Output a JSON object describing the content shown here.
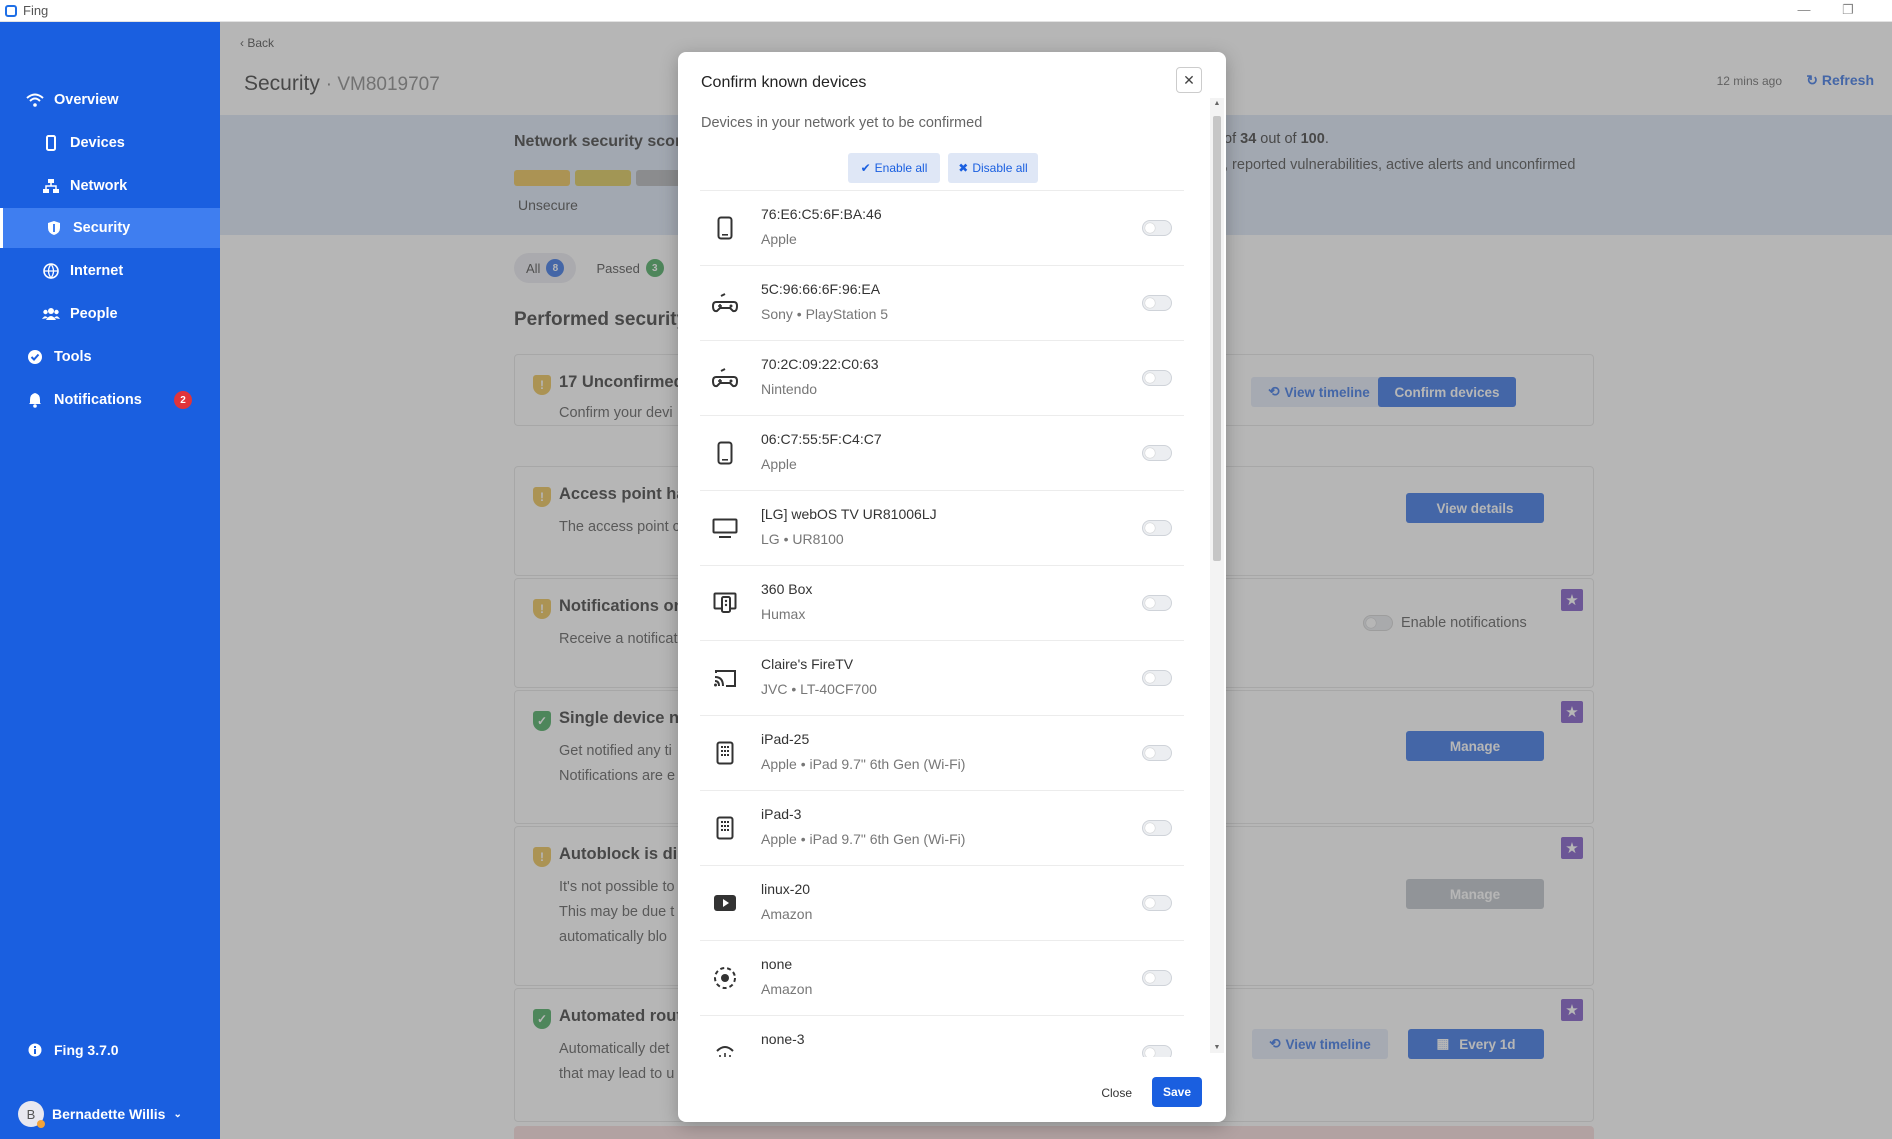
{
  "window": {
    "title": "Fing",
    "minimize": "—",
    "restore": "❐",
    "close": "✕"
  },
  "sidebar": {
    "items": [
      {
        "label": "Overview"
      },
      {
        "label": "Devices"
      },
      {
        "label": "Network"
      },
      {
        "label": "Security"
      },
      {
        "label": "Internet"
      },
      {
        "label": "People"
      },
      {
        "label": "Tools"
      },
      {
        "label": "Notifications",
        "badge": "2"
      }
    ],
    "version": "Fing 3.7.0",
    "user": {
      "initial": "B",
      "name": "Bernadette Willis"
    }
  },
  "header": {
    "back": "Back",
    "title": "Security",
    "network_id": "VM8019707",
    "updated": "12 mins ago",
    "refresh": "Refresh"
  },
  "score": {
    "title": "Network security scor",
    "label": "Unsecure",
    "text_prefix": "of ",
    "value": "34",
    "text_mid": " out of ",
    "max": "100",
    "text_suffix": ".",
    "line2": ", reported vulnerabilities, active alerts and unconfirmed",
    "segment_colors": [
      "#e8b83a",
      "#d6bf3d",
      "#a9abae"
    ]
  },
  "filters": [
    {
      "label": "All",
      "count": "8",
      "color": "#1a5fe0"
    },
    {
      "label": "Passed",
      "count": "3",
      "color": "#2e9e48"
    }
  ],
  "section_title": "Performed security",
  "cards": [
    {
      "title": "17 Unconfirmed",
      "desc": [
        "Confirm your devi"
      ],
      "status": "warning",
      "buttons": [
        "View timeline",
        "Confirm devices"
      ]
    },
    {
      "title": "Access point ha",
      "desc": [
        "The access point c"
      ],
      "status": "warning",
      "buttons": [
        "View details"
      ]
    },
    {
      "title": "Notifications on",
      "desc": [
        "Receive a notificat"
      ],
      "status": "warning",
      "toggle_label": "Enable notifications"
    },
    {
      "title": "Single device no",
      "desc": [
        "Get notified any ti",
        "Notifications are e"
      ],
      "status": "ok",
      "buttons": [
        "Manage"
      ]
    },
    {
      "title": "Autoblock is dis",
      "desc": [
        "It's not possible to",
        "This may be due t",
        "automatically blo"
      ],
      "status": "warning",
      "buttons": [
        "Manage"
      ]
    },
    {
      "title": "Automated rout",
      "desc": [
        "Automatically det",
        "that may lead to u"
      ],
      "status": "ok",
      "buttons": [
        "View timeline",
        "Every 1d"
      ]
    }
  ],
  "modal": {
    "title": "Confirm known devices",
    "subtitle": "Devices in your network yet to be confirmed",
    "enable_all": "Enable all",
    "disable_all": "Disable all",
    "close": "Close",
    "save": "Save",
    "devices": [
      {
        "name": "76:E6:C5:6F:BA:46",
        "vendor": "Apple",
        "icon": "phone-icon"
      },
      {
        "name": "5C:96:66:6F:96:EA",
        "vendor": "Sony • PlayStation 5",
        "icon": "gamepad-icon"
      },
      {
        "name": "70:2C:09:22:C0:63",
        "vendor": "Nintendo",
        "icon": "gamepad-icon"
      },
      {
        "name": "06:C7:55:5F:C4:C7",
        "vendor": "Apple",
        "icon": "phone-icon"
      },
      {
        "name": "[LG] webOS TV UR81006LJ",
        "vendor": "LG • UR8100",
        "icon": "tv-icon"
      },
      {
        "name": "360 Box",
        "vendor": "Humax",
        "icon": "settop-box-icon"
      },
      {
        "name": "Claire's FireTV",
        "vendor": "JVC • LT-40CF700",
        "icon": "cast-icon"
      },
      {
        "name": "iPad-25",
        "vendor": "Apple • iPad 9.7\" 6th Gen (Wi-Fi)",
        "icon": "tablet-icon"
      },
      {
        "name": "iPad-3",
        "vendor": "Apple • iPad 9.7\" 6th Gen (Wi-Fi)",
        "icon": "tablet-icon"
      },
      {
        "name": "linux-20",
        "vendor": "Amazon",
        "icon": "media-player-icon"
      },
      {
        "name": "none",
        "vendor": "Amazon",
        "icon": "sensor-icon"
      },
      {
        "name": "none-3",
        "vendor": "",
        "icon": "fingerprint-icon"
      }
    ]
  }
}
